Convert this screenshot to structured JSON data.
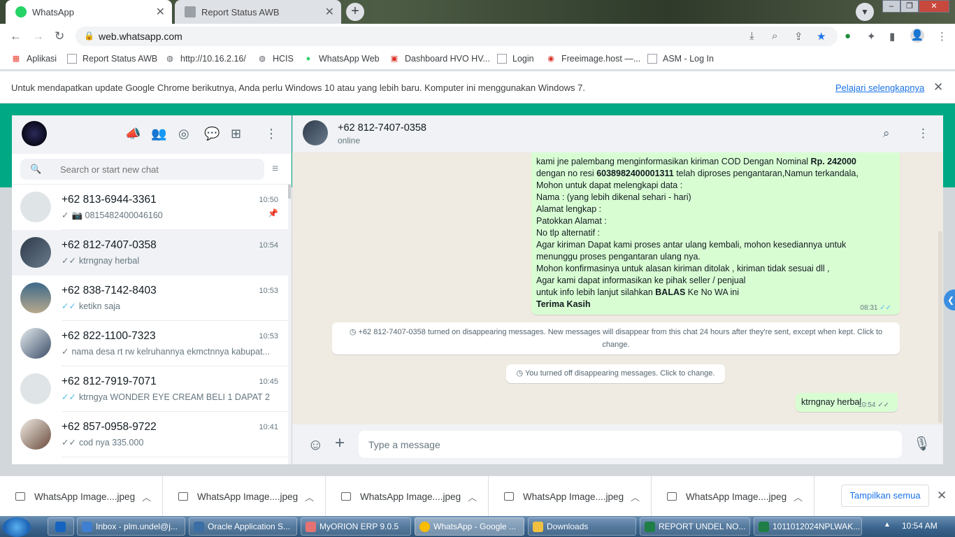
{
  "browser": {
    "tabs": [
      {
        "title": "WhatsApp",
        "active": true
      },
      {
        "title": "Report Status AWB",
        "active": false
      }
    ],
    "url": "web.whatsapp.com",
    "bookmarks": [
      "Aplikasi",
      "Report Status AWB",
      "http://10.16.2.16/",
      "HCIS",
      "WhatsApp Web",
      "Dashboard HVO HV...",
      "Login",
      "Freeimage.host —...",
      "ASM - Log In"
    ],
    "infobar": {
      "message": "Untuk mendapatkan update Google Chrome berikutnya, Anda perlu Windows 10 atau yang lebih baru. Komputer ini menggunakan Windows 7.",
      "link": "Pelajari selengkapnya"
    }
  },
  "sidebar": {
    "search_placeholder": "Search or start new chat",
    "chats": [
      {
        "name": "+62 813-6944-3361",
        "time": "10:50",
        "preview": "0815482400046160",
        "pinned": true,
        "tick": "single",
        "has_camera": true
      },
      {
        "name": "+62 812-7407-0358",
        "time": "10:54",
        "preview": "ktrngnay herbal",
        "selected": true,
        "tick": "double"
      },
      {
        "name": "+62 838-7142-8403",
        "time": "10:53",
        "preview": "ketikn saja",
        "tick": "blue"
      },
      {
        "name": "+62 822-1100-7323",
        "time": "10:53",
        "preview": "nama desa rt rw kelruhannya ekmctnnya kabupat...",
        "tick": "single"
      },
      {
        "name": "+62 812-7919-7071",
        "time": "10:45",
        "preview": "ktrngya WONDER EYE CREAM BELI 1 DAPAT 2",
        "tick": "blue"
      },
      {
        "name": "+62 857-0958-9722",
        "time": "10:41",
        "preview": "cod nya 335.000",
        "tick": "double"
      }
    ]
  },
  "conversation": {
    "contact_name": "+62 812-7407-0358",
    "status": "online",
    "incoming_lines": [
      "kami jne palembang menginformasikan kiriman  COD Dengan Nominal",
      "dengan no resi",
      "Mohon untuk dapat melengkapi data :",
      "Nama : (yang lebih dikenal sehari - hari)",
      "Alamat  lengkap :",
      "Patokkan Alamat :",
      "No tlp alternatif :",
      "Agar kiriman Dapat kami proses antar ulang kembali, mohon kesediannya untuk",
      "menunggu proses pengantaran ulang nya.",
      "Mohon konfirmasinya untuk alasan kiriman ditolak , kiriman tidak sesuai dll ,",
      "Agar kami dapat informasikan ke pihak seller / penjual",
      "untuk info lebih lanjut silahkan",
      "Terima Kasih"
    ],
    "bold_nominal": "Rp. 242000",
    "bold_resi": "6038982400001311",
    "after_resi": " telah diproses pengantaran,Namun terkandala,",
    "bold_balas": "BALAS",
    "after_balas": " Ke No WA ini",
    "incoming_time": "08:31",
    "system_msg_1": "+62 812-7407-0358 turned on disappearing messages. New messages will disappear from this chat 24 hours after they're sent, except when kept. Click to change.",
    "system_msg_2": "You turned off disappearing messages. Click to change.",
    "outgoing_text": "ktrngnay herbal",
    "outgoing_time": "10:54",
    "composer_placeholder": "Type a message"
  },
  "downloads": {
    "items": [
      "WhatsApp Image....jpeg",
      "WhatsApp Image....jpeg",
      "WhatsApp Image....jpeg",
      "WhatsApp Image....jpeg",
      "WhatsApp Image....jpeg"
    ],
    "show_all": "Tampilkan semua"
  },
  "taskbar": {
    "items": [
      "Inbox - plm.undel@j...",
      "Oracle Application S...",
      "MyORION ERP 9.0.5",
      "WhatsApp - Google ...",
      "Downloads",
      "REPORT UNDEL NO...",
      "1011012024NPLWAK..."
    ],
    "clock": "10:54 AM"
  },
  "colors": {
    "accent": "#00a884",
    "bubble_out": "#d9fdd3",
    "chat_bg": "#efeae2"
  }
}
